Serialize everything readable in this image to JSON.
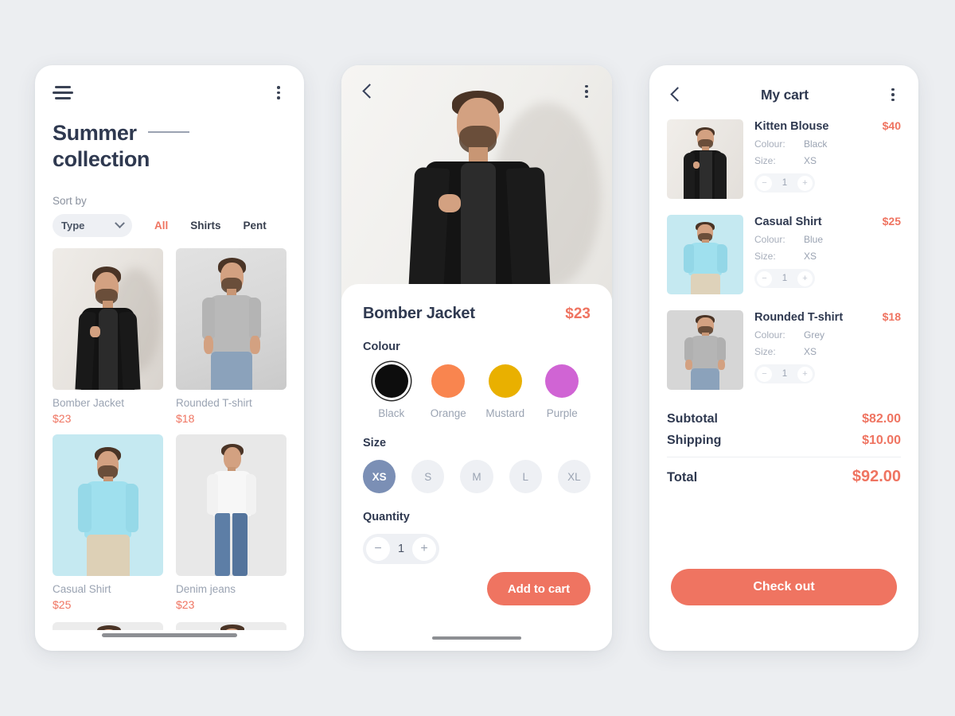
{
  "app": {
    "accent": "#ef7461",
    "title_color": "#2f3950",
    "page_background": "#eceef1"
  },
  "catalog": {
    "menu_icon": "hamburger-icon",
    "more_icon": "more-vertical-icon",
    "title_line1": "Summer",
    "title_line2": "collection",
    "sort_label": "Sort by",
    "type_select": {
      "value": "Type",
      "caret": "chevron-down-icon"
    },
    "filters": [
      {
        "label": "All",
        "active": true
      },
      {
        "label": "Shirts",
        "active": false
      },
      {
        "label": "Pent",
        "active": false
      }
    ],
    "products": [
      {
        "name": "Bomber Jacket",
        "price": "$23",
        "bg": "#e9e6e2",
        "variant": "jacket"
      },
      {
        "name": "Rounded T-shirt",
        "price": "$18",
        "bg": "#dcdcdc",
        "variant": "tshirt"
      },
      {
        "name": "Casual Shirt",
        "price": "$25",
        "bg": "#c8eaf2",
        "variant": "shirt"
      },
      {
        "name": "Denim jeans",
        "price": "$23",
        "bg": "#e6e6e6",
        "variant": "jeans"
      }
    ],
    "partial_row": [
      {
        "bg": "#eceaea",
        "variant": "blazer"
      },
      {
        "bg": "#eceaea",
        "variant": "casual"
      }
    ]
  },
  "detail": {
    "back_icon": "chevron-left-icon",
    "more_icon": "more-vertical-icon",
    "hero_bg": "#f2f1ef",
    "product_name": "Bomber Jacket",
    "product_price": "$23",
    "colour_label": "Colour",
    "colours": [
      {
        "name": "Black",
        "hex": "#0d0d0d",
        "selected": true
      },
      {
        "name": "Orange",
        "hex": "#f9854f",
        "selected": false
      },
      {
        "name": "Mustard",
        "hex": "#e9b000",
        "selected": false
      },
      {
        "name": "Purple",
        "hex": "#d064d4",
        "selected": false
      }
    ],
    "size_label": "Size",
    "sizes": [
      {
        "label": "XS",
        "selected": true
      },
      {
        "label": "S",
        "selected": false
      },
      {
        "label": "M",
        "selected": false
      },
      {
        "label": "L",
        "selected": false
      },
      {
        "label": "XL",
        "selected": false
      }
    ],
    "quantity_label": "Quantity",
    "quantity": {
      "decrement": "−",
      "value": "1",
      "increment": "+"
    },
    "add_to_cart_label": "Add to cart"
  },
  "cart": {
    "back_icon": "chevron-left-icon",
    "more_icon": "more-vertical-icon",
    "title": "My cart",
    "attr_labels": {
      "colour": "Colour:",
      "size": "Size:"
    },
    "items": [
      {
        "name": "Kitten Blouse",
        "price": "$40",
        "colour": "Black",
        "size": "XS",
        "qty": "1",
        "thumb_bg": "#edeae6",
        "variant": "jacket"
      },
      {
        "name": "Casual Shirt",
        "price": "$25",
        "colour": "Blue",
        "size": "XS",
        "qty": "1",
        "thumb_bg": "#c8eaf2",
        "variant": "shirt"
      },
      {
        "name": "Rounded T-shirt",
        "price": "$18",
        "colour": "Grey",
        "size": "XS",
        "qty": "1",
        "thumb_bg": "#d6d6d6",
        "variant": "tshirt"
      }
    ],
    "stepper": {
      "decrement": "−",
      "increment": "+"
    },
    "summary": [
      {
        "label": "Subtotal",
        "value": "$82.00"
      },
      {
        "label": "Shipping",
        "value": "$10.00"
      }
    ],
    "total": {
      "label": "Total",
      "value": "$92.00"
    },
    "checkout_label": "Check out"
  }
}
